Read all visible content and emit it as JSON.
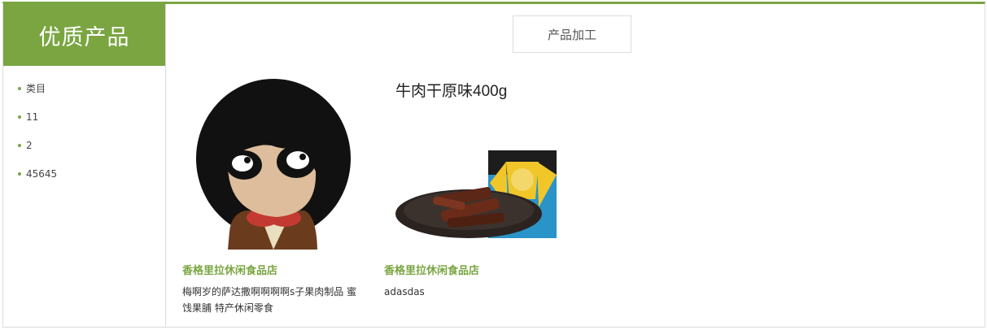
{
  "sidebar": {
    "title": "优质产品",
    "items": [
      {
        "label": "类目"
      },
      {
        "label": "11"
      },
      {
        "label": "2"
      },
      {
        "label": "45645"
      }
    ]
  },
  "main": {
    "tab_label": "产品加工",
    "products": [
      {
        "shop_name": "香格里拉休闲食品店",
        "description": "梅啊岁的萨达撒啊啊啊啊s子果肉制品 蜜饯果脯 特产休闲零食",
        "image_icon": "cartoon-girl-avatar"
      },
      {
        "shop_name": "香格里拉休闲食品店",
        "description": "adasdas",
        "image_icon": "beef-jerky-package",
        "image_text": "牛肉干原味400g"
      }
    ]
  },
  "colors": {
    "accent": "#7aa541",
    "border": "#dcdcdc"
  }
}
